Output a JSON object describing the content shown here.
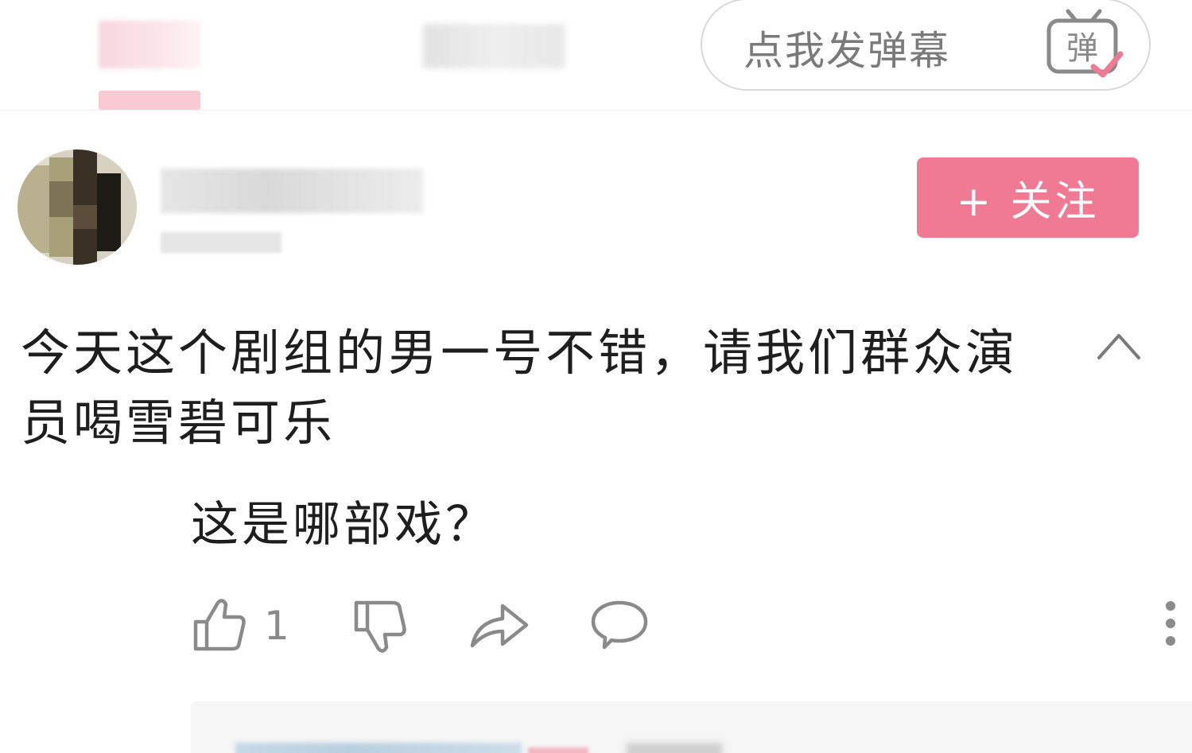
{
  "danmaku": {
    "placeholder": "点我发弹幕",
    "icon_label": "弹",
    "icon": "danmaku-toggle-icon"
  },
  "user": {
    "follow_label": "+ 关注"
  },
  "post": {
    "text": "今天这个剧组的男一号不错，请我们群众演员喝雪碧可乐",
    "reply_text": "这是哪部戏？"
  },
  "actions": {
    "like_count": "1",
    "icons": [
      "thumbs-up-icon",
      "thumbs-down-icon",
      "share-icon",
      "comment-icon",
      "more-icon"
    ]
  },
  "colors": {
    "accent": "#f07a93",
    "text": "#1e1e1e",
    "muted": "#8a8a8a"
  }
}
